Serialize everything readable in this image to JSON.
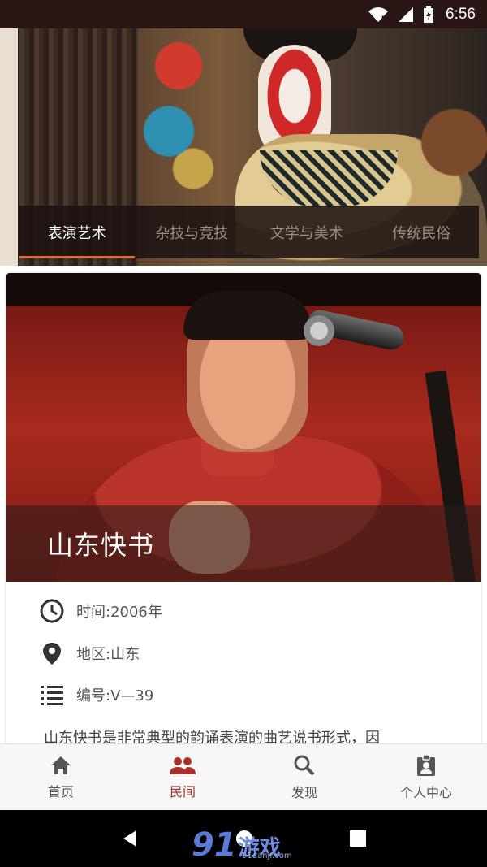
{
  "status_bar": {
    "time": "6:56"
  },
  "tabs": [
    {
      "label": "表演艺术",
      "active": true
    },
    {
      "label": "杂技与竞技",
      "active": false
    },
    {
      "label": "文学与美术",
      "active": false
    },
    {
      "label": "传统民俗",
      "active": false
    }
  ],
  "card": {
    "title": "山东快书",
    "time": "时间:2006年",
    "region": "地区:山东",
    "code": "编号:V—39",
    "description": "山东快书是非常典型的韵诵表演的曲艺说书形式，因"
  },
  "bottom_nav": [
    {
      "label": "首页",
      "icon": "home-icon",
      "active": false
    },
    {
      "label": "民间",
      "icon": "people-icon",
      "active": true
    },
    {
      "label": "发现",
      "icon": "search-icon",
      "active": false
    },
    {
      "label": "个人中心",
      "icon": "profile-icon",
      "active": false
    }
  ],
  "watermark": {
    "big": "91",
    "cn": "游戏",
    "url": "91danji.com"
  },
  "colors": {
    "accent": "#a8322a",
    "tab_indicator": "#e06a3a",
    "status_bar": "#2a1614"
  }
}
